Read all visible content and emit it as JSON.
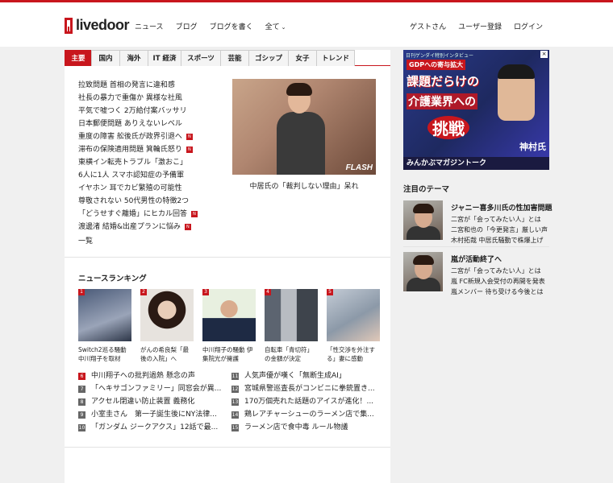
{
  "header": {
    "logo": "livedoor",
    "nav": [
      "ニュース",
      "ブログ",
      "ブログを書く",
      "全て"
    ],
    "user_nav": [
      "ゲストさん",
      "ユーザー登録",
      "ログイン"
    ]
  },
  "tabs": [
    "主要",
    "国内",
    "海外",
    "IT 経済",
    "スポーツ",
    "芸能",
    "ゴシップ",
    "女子",
    "トレンド"
  ],
  "top_news": [
    {
      "text": "拉致問題 首相の発言に違和感",
      "new": false
    },
    {
      "text": "社長の暴力で重傷か 異様な社風",
      "new": false
    },
    {
      "text": "平気で嘘つく 2万給付案バッサリ",
      "new": false
    },
    {
      "text": "日本郵便問題 ありえないレベル",
      "new": false
    },
    {
      "text": "重度の障害 舩後氏が政界引退へ",
      "new": true
    },
    {
      "text": "滞布の保険適用問題 箕輪氏怒り",
      "new": true
    },
    {
      "text": "東横イン転売トラブル「激おこ」",
      "new": false
    },
    {
      "text": "6人に1人 スマホ認知症の予備軍",
      "new": false
    },
    {
      "text": "イヤホン 耳でカビ繁殖の可能性",
      "new": false
    },
    {
      "text": "尊敬されない 50代男性の特徴2つ",
      "new": false
    },
    {
      "text": "「どうせすぐ離婚」にヒカル回答",
      "new": true
    },
    {
      "text": "渡邊渚 結婚&出産プランに悩み",
      "new": true
    }
  ],
  "top_news_more": "一覧",
  "feature": {
    "caption": "中居氏の「裁判しない理由」呆れ",
    "image_label": "FLASH"
  },
  "ranking": {
    "title": "ニュースランキング",
    "thumbs": [
      {
        "num": "1",
        "caption": "Switch2巡る騒動 中川翔子を取材"
      },
      {
        "num": "2",
        "caption": "がんの希良梨「最後の入院」へ"
      },
      {
        "num": "3",
        "caption": "中川翔子の騒動 伊集院光が擁護"
      },
      {
        "num": "4",
        "caption": "自転車「青切符」の金額が決定"
      },
      {
        "num": "5",
        "caption": "「性交渉を外注する」妻に感動"
      }
    ],
    "list_left": [
      {
        "num": "6",
        "text": "中川翔子への批判過熱 懸念の声"
      },
      {
        "num": "7",
        "text": "「ヘキサゴンファミリー」同窓会が異..."
      },
      {
        "num": "8",
        "text": "アクセル閉違い防止装置 義務化"
      },
      {
        "num": "9",
        "text": "小室圭さん　第一子誕生後にNY法律..."
      },
      {
        "num": "10",
        "text": "「ガンダム ジークアクス」12話で最..."
      }
    ],
    "list_right": [
      {
        "num": "11",
        "text": "人気声優が嘆く「無断生成AI」"
      },
      {
        "num": "12",
        "text": "宮城県警巡査長がコンビニに拳銃置き..."
      },
      {
        "num": "13",
        "text": "170万個売れた話題のアイスが進化！..."
      },
      {
        "num": "14",
        "text": "鶏レアチャーシューのラーメン店で集..."
      },
      {
        "num": "15",
        "text": "ラーメン店で食中毒 ルール物議"
      }
    ]
  },
  "ad": {
    "top": "日刊ゲンダイ特別インタビュー",
    "badge": "GDPへの寄与拡大",
    "line1": "課題だらけの",
    "line2": "介護業界への",
    "line3": "挑戦",
    "name": "神村氏",
    "bottom": "みんかぶマガジントーク"
  },
  "themes": {
    "title": "注目のテーマ",
    "items": [
      {
        "title": "ジャニー喜多川氏の性加害問題",
        "links": [
          "二宮が「会ってみたい人」とは",
          "二宮和也の「今更発言」厳しい声",
          "木村拓哉 中居氏騒動で株爆上げ"
        ]
      },
      {
        "title": "嵐が活動終了へ",
        "links": [
          "二宮が「会ってみたい人」とは",
          "嵐 FC新規入会受付の再開を発表",
          "嵐メンバー 待ち受ける今後とは"
        ]
      }
    ]
  }
}
